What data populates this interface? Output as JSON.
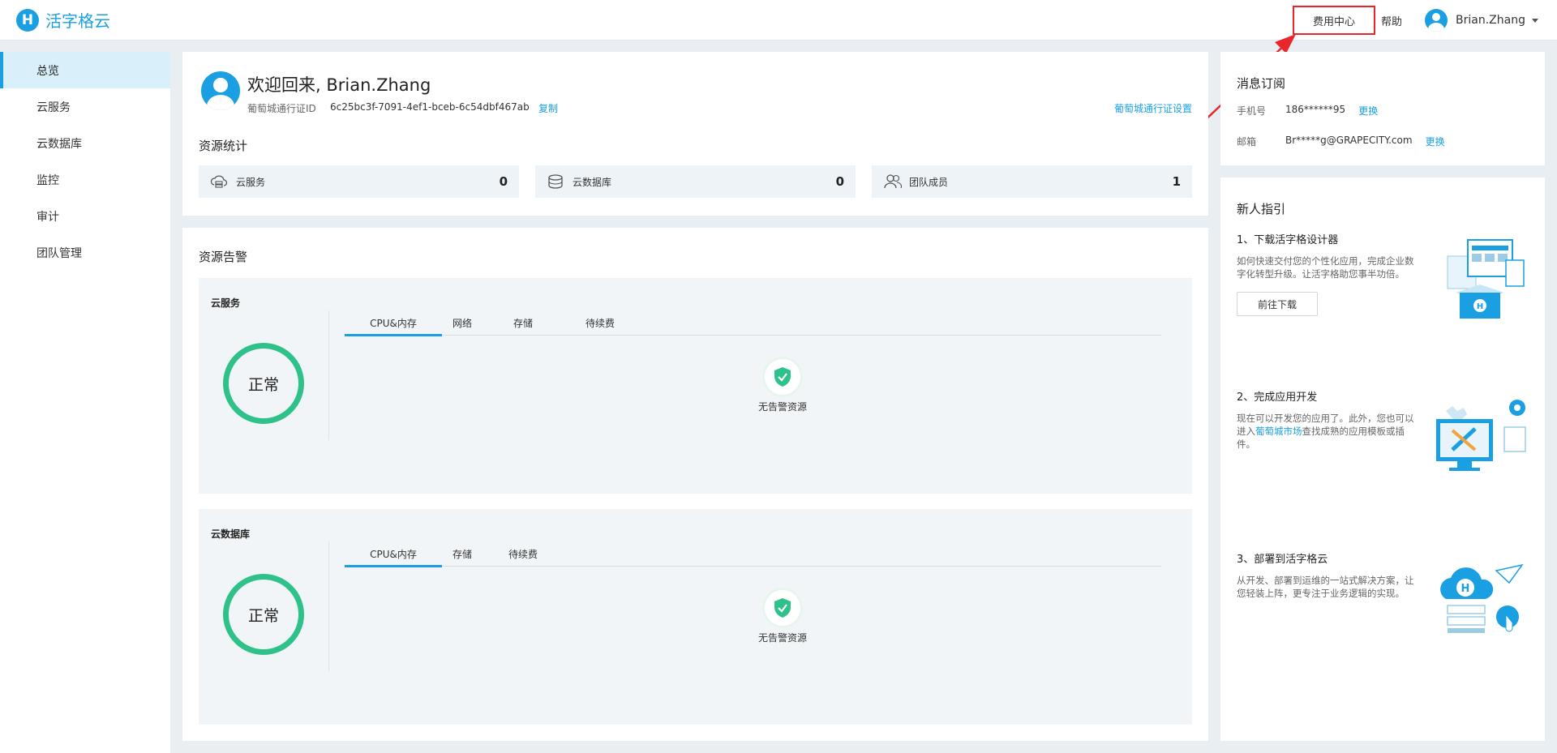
{
  "header": {
    "logo_text": "活字格云",
    "fee_center": "费用中心",
    "help": "帮助",
    "user_name": "Brian.Zhang"
  },
  "sidebar": {
    "items": [
      {
        "label": "总览",
        "active": true
      },
      {
        "label": "云服务"
      },
      {
        "label": "云数据库"
      },
      {
        "label": "监控"
      },
      {
        "label": "审计"
      },
      {
        "label": "团队管理"
      }
    ]
  },
  "welcome": {
    "title": "欢迎回来, Brian.Zhang",
    "pass_label": "葡萄城通行证ID",
    "pass_id": "6c25bc3f-7091-4ef1-bceb-6c54dbf467ab",
    "copy": "复制",
    "pass_settings": "葡萄城通行证设置"
  },
  "stats": {
    "title": "资源统计",
    "items": [
      {
        "label": "云服务",
        "value": "0",
        "icon": "cloud-server-icon"
      },
      {
        "label": "云数据库",
        "value": "0",
        "icon": "database-icon"
      },
      {
        "label": "团队成员",
        "value": "1",
        "icon": "team-icon"
      }
    ]
  },
  "alerts": {
    "title": "资源告警",
    "panels": [
      {
        "title": "云服务",
        "status": "正常",
        "tabs": [
          "CPU&内存",
          "网络",
          "存储",
          "待续费"
        ],
        "empty_text": "无告警资源"
      },
      {
        "title": "云数据库",
        "status": "正常",
        "tabs": [
          "CPU&内存",
          "存储",
          "待续费"
        ],
        "empty_text": "无告警资源"
      }
    ]
  },
  "subscribe": {
    "title": "消息订阅",
    "phone_label": "手机号",
    "phone_value": "186******95",
    "email_label": "邮箱",
    "email_value": "Br*****g@GRAPECITY.com",
    "change": "更换"
  },
  "guide": {
    "title": "新人指引",
    "steps": [
      {
        "title": "1、下载活字格设计器",
        "desc": "如何快速交付您的个性化应用，完成企业数字化转型升级。让活字格助您事半功倍。",
        "button": "前往下载"
      },
      {
        "title": "2、完成应用开发",
        "desc_before": "现在可以开发您的应用了。此外，您也可以进入",
        "desc_link": "葡萄城市场",
        "desc_after": "查找成熟的应用模板或插件。"
      },
      {
        "title": "3、部署到活字格云",
        "desc": "从开发、部署到运维的一站式解决方案，让您轻装上阵，更专注于业务逻辑的实现。"
      }
    ]
  },
  "colors": {
    "brand": "#1aa0e2",
    "status_ok": "#2ec28a",
    "highlight": "#e8262b"
  }
}
